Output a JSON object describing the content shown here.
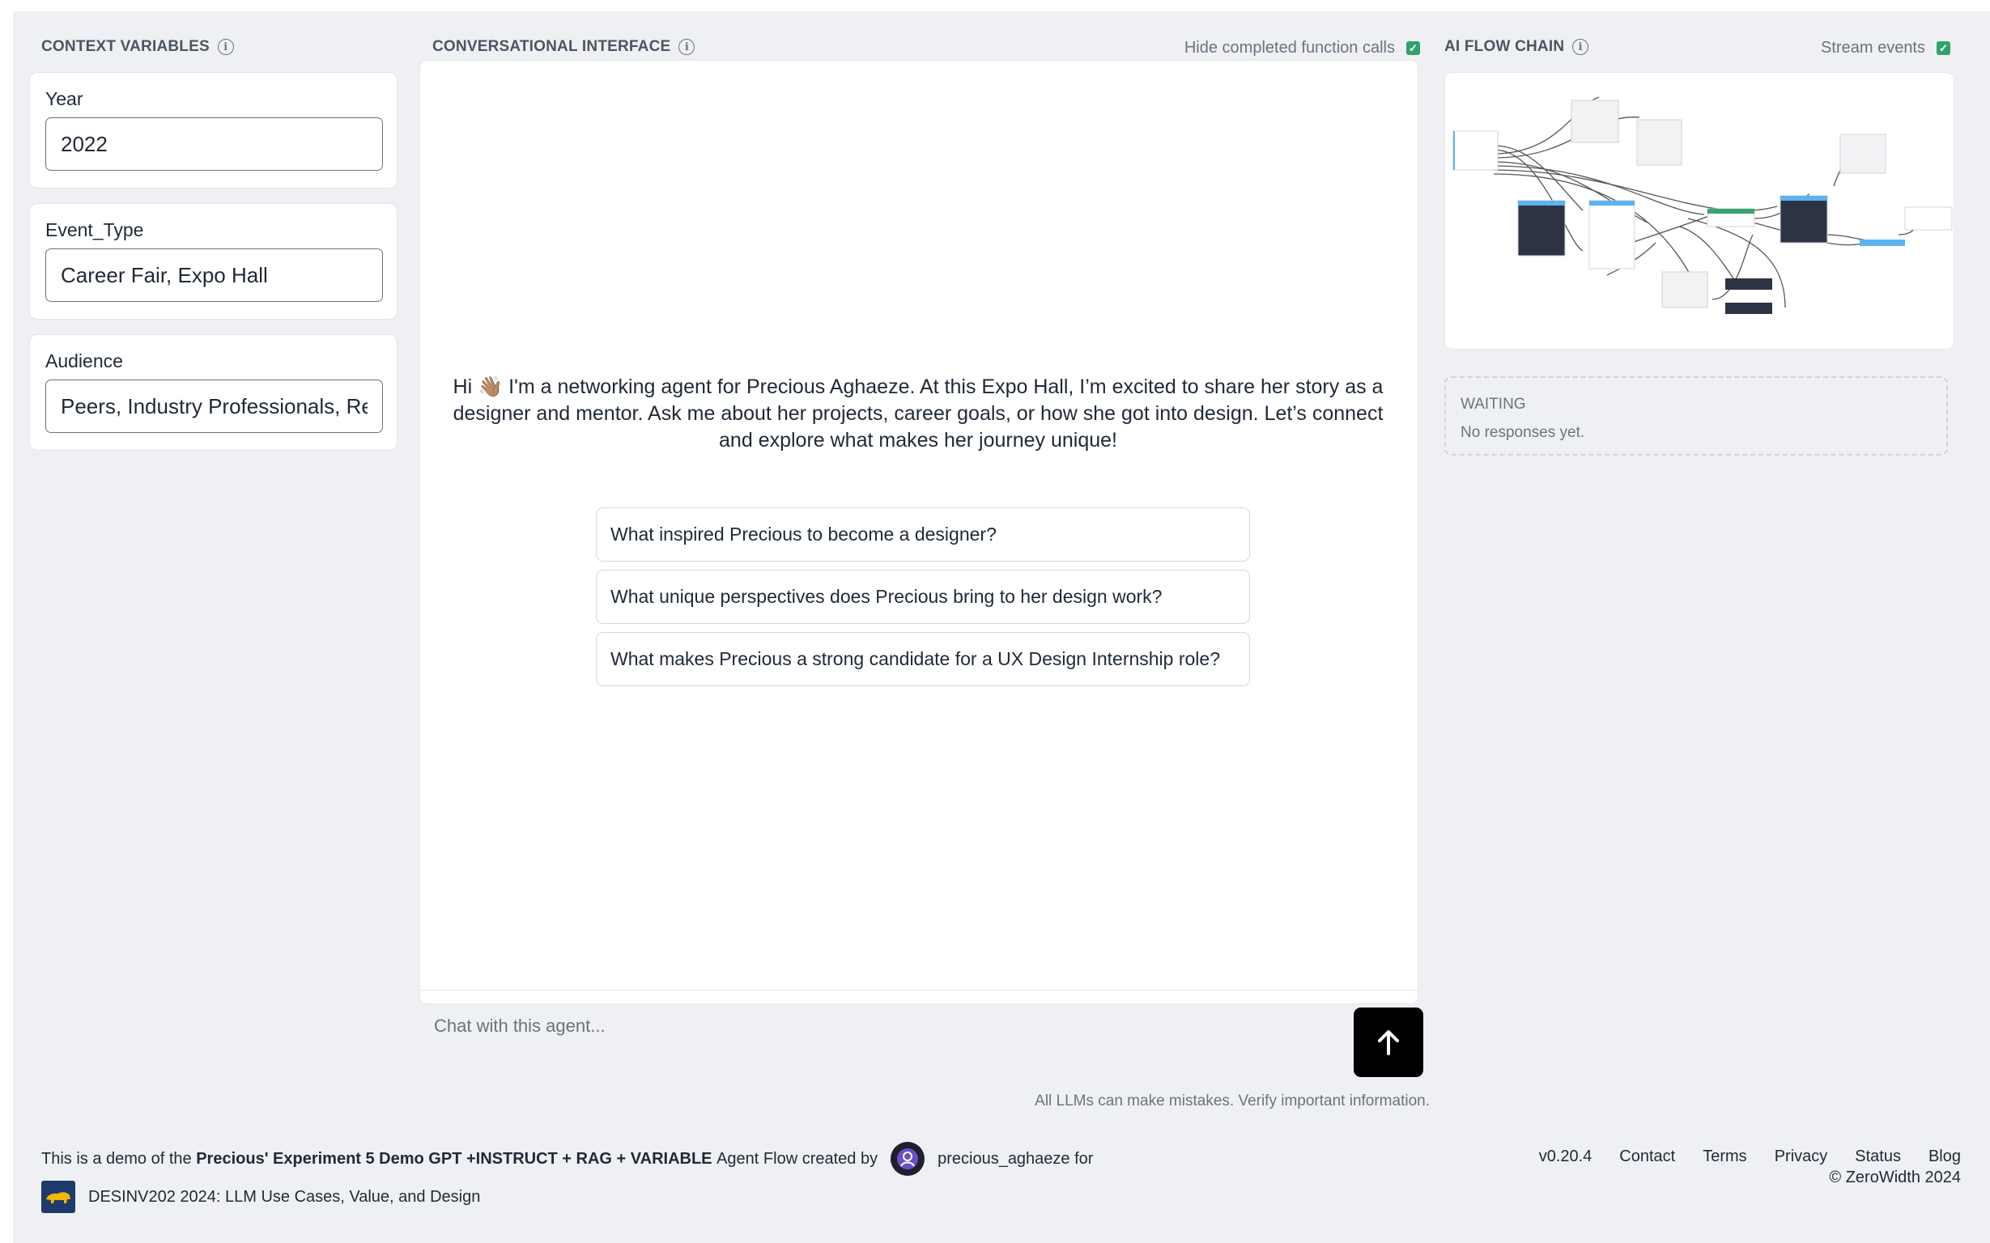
{
  "context_panel": {
    "title": "CONTEXT VARIABLES",
    "variables": [
      {
        "label": "Year",
        "value": "2022"
      },
      {
        "label": "Event_Type",
        "value": "Career Fair, Expo Hall"
      },
      {
        "label": "Audience",
        "value": "Peers, Industry Professionals, Recruiters"
      }
    ]
  },
  "chat": {
    "title": "CONVERSATIONAL INTERFACE",
    "hide_completed_label": "Hide completed function calls",
    "hide_completed_checked": true,
    "greeting": "Hi 👋🏽 I'm a networking agent for Precious Aghaeze. At this Expo Hall, I’m excited to share her story as a designer and mentor. Ask me about her projects, career goals, or how she got into design. Let’s connect and explore what makes her journey unique!",
    "suggestions": [
      "What inspired Precious to become a designer?",
      "What unique perspectives does Precious bring to her design work?",
      "What makes Precious a strong candidate for a UX Design Internship role?"
    ],
    "input_placeholder": "Chat with this agent...",
    "send_icon": "arrow-up-icon",
    "disclaimer": "All LLMs can make mistakes. Verify important information."
  },
  "flow": {
    "title": "AI FLOW CHAIN",
    "stream_events_label": "Stream events",
    "stream_events_checked": true,
    "status_title": "WAITING",
    "status_text": "No responses yet."
  },
  "footer": {
    "prefix": "This is a demo of the",
    "flow_name": "Precious' Experiment 5 Demo GPT +INSTRUCT + RAG + VARIABLE",
    "middle": "Agent Flow created by",
    "username": "precious_aghaeze for",
    "course": "DESINV202 2024: LLM Use Cases, Value, and Design",
    "links": [
      "v0.20.4",
      "Contact",
      "Terms",
      "Privacy",
      "Status",
      "Blog"
    ],
    "copyright": "© ZeroWidth 2024"
  },
  "colors": {
    "page_background": "#eff0f3",
    "checkbox_green": "#2fa36b",
    "send_button": "#000000",
    "node_blue": "#5ab4f0",
    "node_dark": "#2c3444",
    "node_green": "#3aa46f"
  }
}
